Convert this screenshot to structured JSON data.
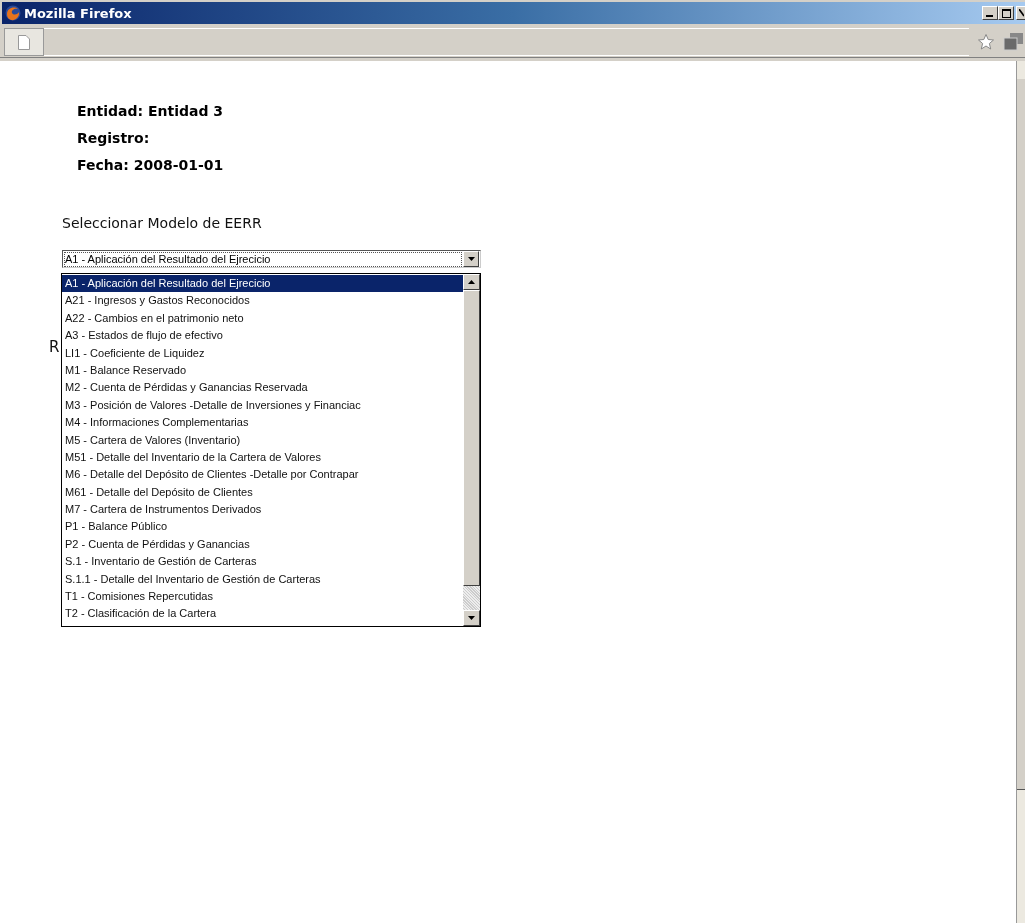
{
  "window": {
    "title": "Mozilla Firefox"
  },
  "info_lines": [
    "Entidad: Entidad 3",
    "Registro:",
    "Fecha: 2008-01-01"
  ],
  "select_label": "Seleccionar Modelo de EERR",
  "select": {
    "value": "A1 - Aplicación del Resultado del Ejrecicio",
    "expanded": true,
    "options": [
      {
        "label": "A1 - Aplicación del Resultado del Ejrecicio",
        "selected": true
      },
      {
        "label": "A21 - Ingresos y Gastos Reconocidos",
        "selected": false
      },
      {
        "label": "A22 - Cambios en el patrimonio neto",
        "selected": false
      },
      {
        "label": "A3 - Estados de flujo de efectivo",
        "selected": false
      },
      {
        "label": "LI1 - Coeficiente de Liquidez",
        "selected": false
      },
      {
        "label": "M1 - Balance Reservado",
        "selected": false
      },
      {
        "label": "M2 - Cuenta de Pérdidas y Ganancias Reservada",
        "selected": false
      },
      {
        "label": "M3 - Posición de Valores -Detalle de Inversiones y Financiac",
        "selected": false
      },
      {
        "label": "M4 - Informaciones Complementarias",
        "selected": false
      },
      {
        "label": "M5 - Cartera de Valores (Inventario)",
        "selected": false
      },
      {
        "label": "M51 - Detalle del Inventario de la Cartera de Valores",
        "selected": false
      },
      {
        "label": "M6 - Detalle del Depósito de Clientes -Detalle por Contrapar",
        "selected": false
      },
      {
        "label": "M61 - Detalle del Depósito de Clientes",
        "selected": false
      },
      {
        "label": "M7 - Cartera de Instrumentos Derivados",
        "selected": false
      },
      {
        "label": "P1 - Balance Público",
        "selected": false
      },
      {
        "label": "P2 - Cuenta de Pérdidas y Ganancias",
        "selected": false
      },
      {
        "label": "S.1 - Inventario de Gestión de Carteras",
        "selected": false
      },
      {
        "label": "S.1.1 - Detalle del Inventario de Gestión de Carteras",
        "selected": false
      },
      {
        "label": "T1 - Comisiones Repercutidas",
        "selected": false
      },
      {
        "label": "T2 - Clasificación de la Cartera",
        "selected": false
      }
    ]
  },
  "hidden_label": "R"
}
